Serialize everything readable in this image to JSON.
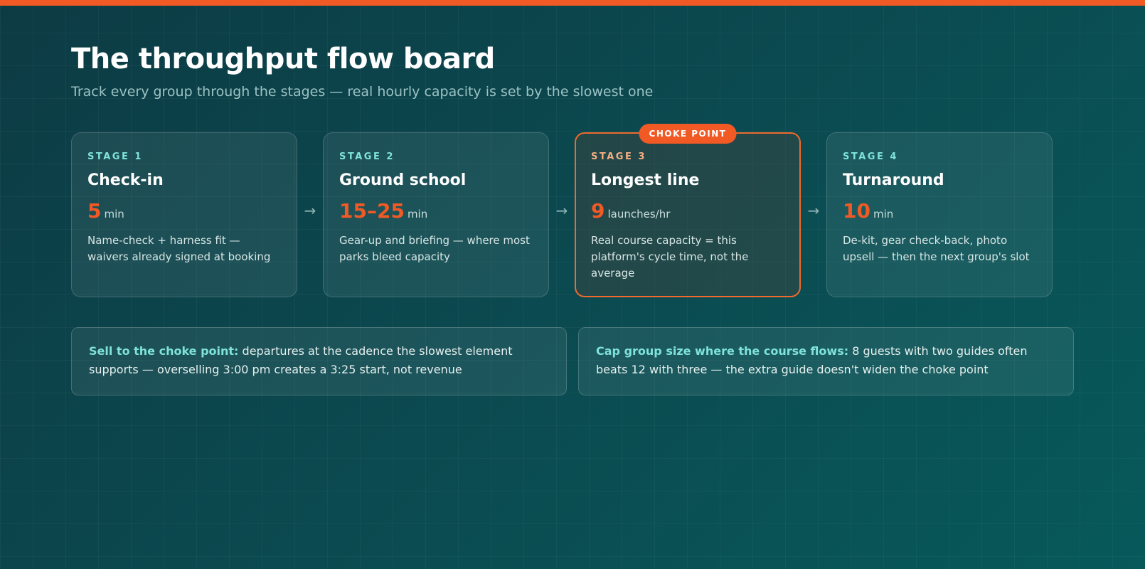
{
  "header": {
    "title": "The throughput flow board",
    "subtitle": "Track every group through the stages — real hourly capacity is set by the slowest one"
  },
  "stages": [
    {
      "label": "STAGE 1",
      "name": "Check-in",
      "value": "5",
      "unit": "min",
      "desc": "Name-check + harness fit — waivers already signed at booking"
    },
    {
      "label": "STAGE 2",
      "name": "Ground school",
      "value": "15–25",
      "unit": "min",
      "desc": "Gear-up and briefing — where most parks bleed capacity"
    },
    {
      "label": "STAGE 3",
      "name": "Longest line",
      "value": "9",
      "unit": "launches/hr",
      "desc": "Real course capacity = this platform's cycle time, not the average",
      "badge": "CHOKE POINT"
    },
    {
      "label": "STAGE 4",
      "name": "Turnaround",
      "value": "10",
      "unit": "min",
      "desc": "De-kit, gear check-back, photo upsell — then the next group's slot"
    }
  ],
  "arrow_glyph": "→",
  "notes": [
    {
      "lead": "Sell to the choke point:",
      "text": " departures at the cadence the slowest element supports — overselling 3:00 pm creates a 3:25 start, not revenue"
    },
    {
      "lead": "Cap group size where the course flows:",
      "text": " 8 guests with two guides often beats 12 with three — the extra guide doesn't widen the choke point"
    }
  ],
  "colors": {
    "accent": "#f15a24",
    "teal_label": "#7fe3d9",
    "background": "#0b4148"
  }
}
